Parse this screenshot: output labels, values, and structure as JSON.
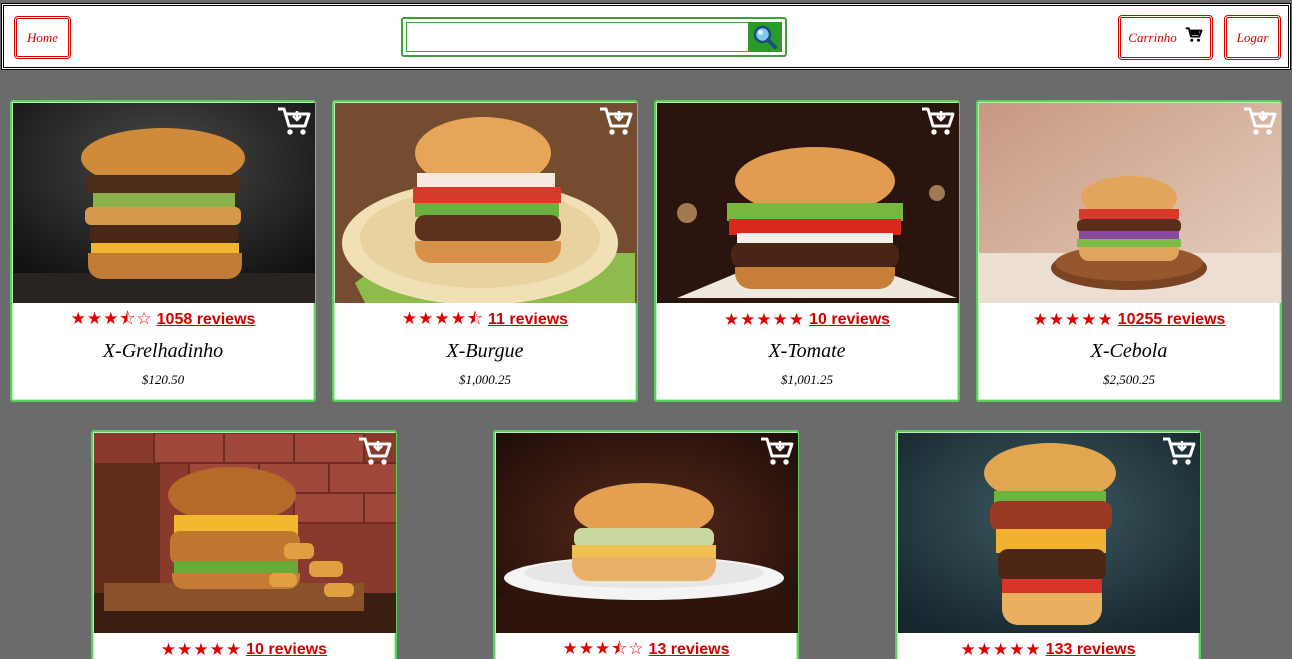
{
  "header": {
    "home_label": "Home",
    "cart_label": "Carrinho",
    "login_label": "Logar",
    "search_value": "",
    "search_icon": "magnifier-icon"
  },
  "products": [
    {
      "name": "X-Grelhadinho",
      "price": "$120.50",
      "stars": "★★★⯪☆",
      "rating": 3.5,
      "reviews": "1058 reviews"
    },
    {
      "name": "X-Burgue",
      "price": "$1,000.25",
      "stars": "★★★★⯪",
      "rating": 4.5,
      "reviews": "11 reviews"
    },
    {
      "name": "X-Tomate",
      "price": "$1,001.25",
      "stars": "★★★★★",
      "rating": 5,
      "reviews": "10 reviews"
    },
    {
      "name": "X-Cebola",
      "price": "$2,500.25",
      "stars": "★★★★★",
      "rating": 5,
      "reviews": "10255 reviews"
    },
    {
      "name": "",
      "price": "",
      "stars": "★★★★★",
      "rating": 5,
      "reviews": "10 reviews"
    },
    {
      "name": "",
      "price": "",
      "stars": "★★★⯪☆",
      "rating": 3.5,
      "reviews": "13 reviews"
    },
    {
      "name": "",
      "price": "",
      "stars": "★★★★★",
      "rating": 5,
      "reviews": "133 reviews"
    }
  ],
  "colors": {
    "accent_red": "#d40000",
    "accent_green": "#2a9a2a",
    "page_bg": "#6b6b6b"
  }
}
